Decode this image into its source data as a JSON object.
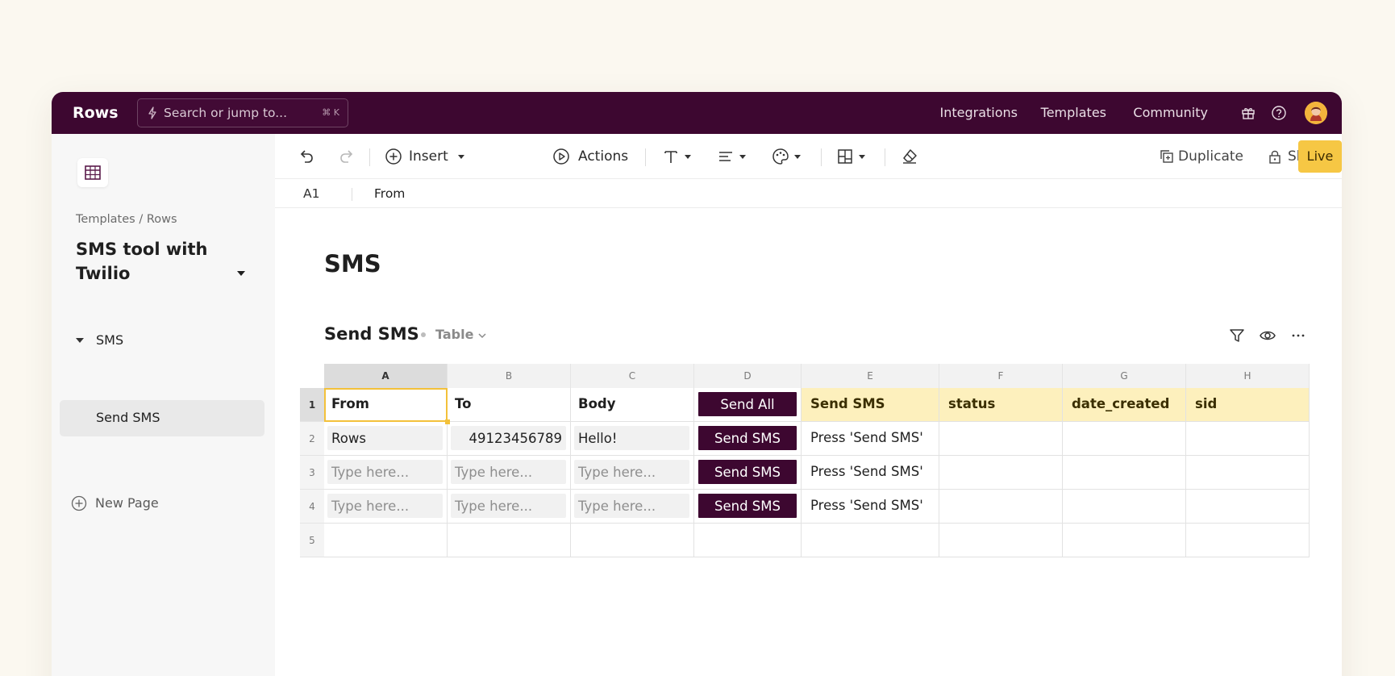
{
  "app": {
    "logo": "Rows",
    "search_placeholder": "Search or jump to...",
    "search_shortcut": "⌘ K",
    "nav": [
      "Integrations",
      "Templates",
      "Community"
    ]
  },
  "sidebar": {
    "breadcrumb": "Templates / Rows",
    "doc_title": "SMS tool with Twilio",
    "section": "SMS",
    "page": "Send SMS",
    "new_page": "New Page"
  },
  "toolbar": {
    "insert": "Insert",
    "actions": "Actions",
    "duplicate": "Duplicate",
    "share": "Share",
    "live": "Live"
  },
  "formula_bar": {
    "cell_ref": "A1",
    "value": "From"
  },
  "page": {
    "title": "SMS",
    "table_title": "Send SMS",
    "table_view": "Table"
  },
  "grid": {
    "columns": [
      "A",
      "B",
      "C",
      "D",
      "E",
      "F",
      "G",
      "H"
    ],
    "rows": [
      "1",
      "2",
      "3",
      "4",
      "5"
    ],
    "header": [
      "From",
      "To",
      "Body",
      "Send All",
      "Send SMS",
      "status",
      "date_created",
      "sid"
    ],
    "data": [
      {
        "from": "Rows",
        "to": "49123456789",
        "body": "Hello!",
        "action": "Send SMS",
        "send_sms": "Press 'Send SMS'"
      },
      {
        "from": "Type here...",
        "to": "Type here...",
        "body": "Type here...",
        "action": "Send SMS",
        "send_sms": "Press 'Send SMS'"
      },
      {
        "from": "Type here...",
        "to": "Type here...",
        "body": "Type here...",
        "action": "Send SMS",
        "send_sms": "Press 'Send SMS'"
      }
    ]
  },
  "colors": {
    "brand": "#3d0730",
    "live": "#f6c744",
    "header_highlight": "#fdf0bd",
    "selection": "#f3c13a"
  }
}
